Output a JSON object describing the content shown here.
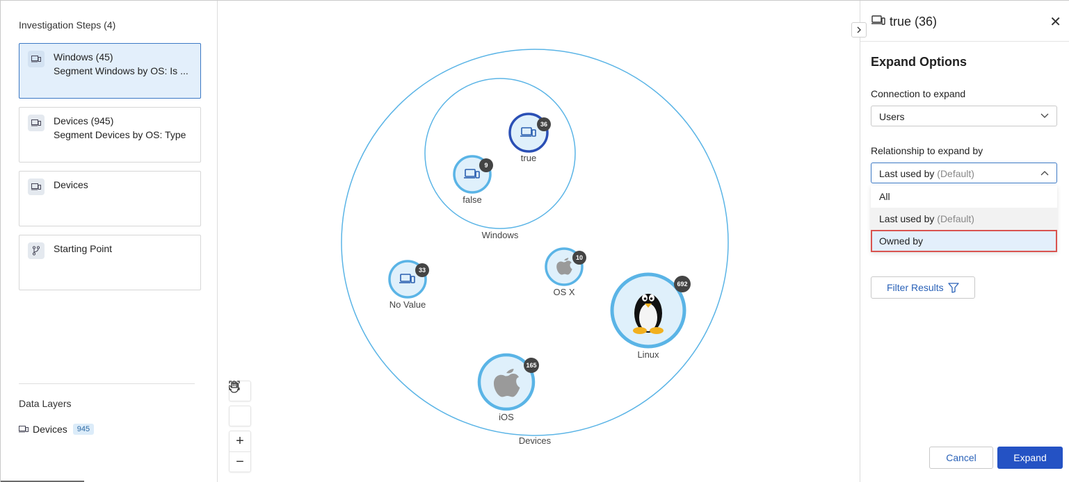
{
  "left_panel": {
    "title": "Investigation Steps (4)",
    "steps": [
      {
        "title": "Windows (45)",
        "subtitle": "Segment Windows by OS: Is ...",
        "icon": "device-icon",
        "active": true
      },
      {
        "title": "Devices (945)",
        "subtitle": "Segment Devices by OS: Type",
        "icon": "device-icon",
        "active": false
      },
      {
        "title": "Devices",
        "subtitle": "",
        "icon": "device-icon",
        "active": false
      },
      {
        "title": "Starting Point",
        "subtitle": "",
        "icon": "branch-icon",
        "active": false
      }
    ],
    "data_layers": {
      "title": "Data Layers",
      "items": [
        {
          "label": "Devices",
          "count": "945",
          "icon": "device-icon"
        }
      ]
    }
  },
  "canvas": {
    "groups": {
      "outer": "Devices",
      "inner": "Windows"
    },
    "nodes": [
      {
        "label": "true",
        "count": "36",
        "icon": "device-icon"
      },
      {
        "label": "false",
        "count": "9",
        "icon": "device-icon"
      },
      {
        "label": "No Value",
        "count": "33",
        "icon": "device-icon"
      },
      {
        "label": "OS X",
        "count": "10",
        "icon": "apple-icon"
      },
      {
        "label": "Linux",
        "count": "692",
        "icon": "tux-icon"
      },
      {
        "label": "iOS",
        "count": "165",
        "icon": "apple-icon"
      }
    ],
    "tools": [
      "hand-icon",
      "fit-screen-icon",
      "zoom-in-icon",
      "zoom-out-icon"
    ]
  },
  "right_panel": {
    "header_title": "true (36)",
    "section_title": "Expand Options",
    "connection_label": "Connection to expand",
    "connection_value": "Users",
    "relationship_label": "Relationship to expand by",
    "relationship_value": "Last used by",
    "relationship_default": "(Default)",
    "options": [
      {
        "label": "All",
        "suffix": ""
      },
      {
        "label": "Last used by",
        "suffix": "(Default)"
      },
      {
        "label": "Owned by",
        "suffix": ""
      }
    ],
    "filter_button": "Filter Results",
    "cancel_button": "Cancel",
    "expand_button": "Expand"
  },
  "colors": {
    "accent": "#2452c4",
    "node_ring": "#5ab4e6",
    "node_fill": "#dff0fb",
    "selected_ring": "#2a4fb5",
    "highlight_outline": "#d9534f"
  }
}
